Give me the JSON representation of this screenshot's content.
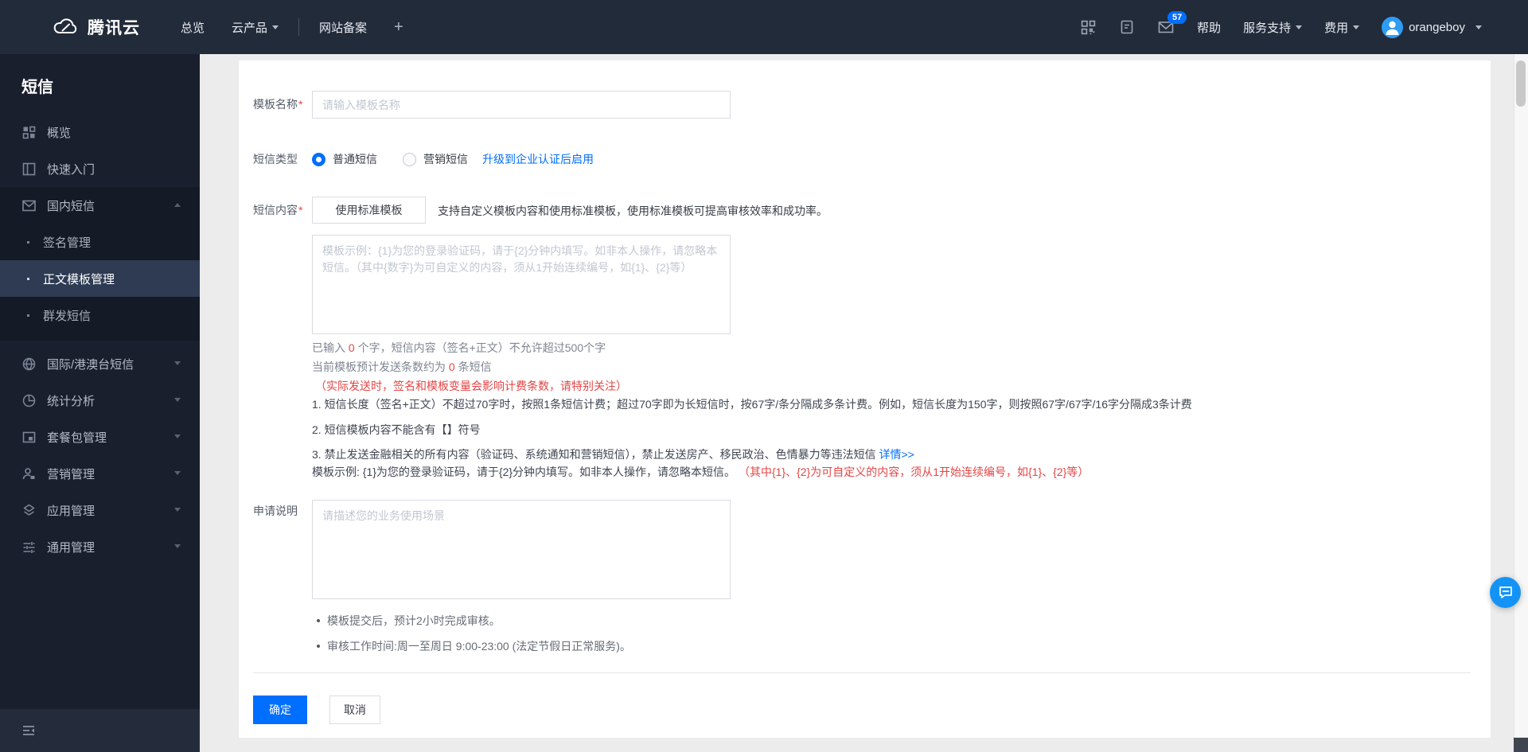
{
  "colors": {
    "accent": "#006eff",
    "danger_red": "#e54545",
    "navbar_bg": "#222b3a",
    "sidebar_bg": "#191f2d",
    "sidebar_active_bg": "#2e3b52",
    "chat_button_blue": "#1493f6"
  },
  "navbar": {
    "brand": "腾讯云",
    "overview": "总览",
    "products": "云产品",
    "beian": "网站备案",
    "plus": "+",
    "mail_badge": "57",
    "help": "帮助",
    "support": "服务支持",
    "billing": "费用",
    "username": "orangeboy",
    "icons": [
      "qr-code-icon",
      "document-icon",
      "mail-icon",
      "avatar"
    ]
  },
  "sidebar": {
    "title": "短信",
    "items": [
      {
        "label": "概览",
        "icon": "grid-icon"
      },
      {
        "label": "快速入门",
        "icon": "quickstart-icon"
      },
      {
        "label": "国内短信",
        "icon": "envelope-icon",
        "expanded": true
      },
      {
        "label": "国际/港澳台短信",
        "icon": "globe-icon"
      },
      {
        "label": "统计分析",
        "icon": "pie-chart-icon"
      },
      {
        "label": "套餐包管理",
        "icon": "package-icon"
      },
      {
        "label": "营销管理",
        "icon": "person-icon"
      },
      {
        "label": "应用管理",
        "icon": "layers-icon"
      },
      {
        "label": "通用管理",
        "icon": "sliders-icon"
      }
    ],
    "sub_items": [
      {
        "label": "签名管理",
        "active": false
      },
      {
        "label": "正文模板管理",
        "active": true
      },
      {
        "label": "群发短信",
        "active": false
      }
    ]
  },
  "form": {
    "template_name": {
      "label": "模板名称",
      "required": "*",
      "placeholder": "请输入模板名称"
    },
    "sms_type": {
      "label": "短信类型",
      "option1": "普通短信",
      "option2": "营销短信",
      "upgrade_link": "升级到企业认证后启用"
    },
    "sms_content": {
      "label": "短信内容",
      "required": "*",
      "standard_template_button": "使用标准模板",
      "hint": "支持自定义模板内容和使用标准模板，使用标准模板可提高审核效率和成功率。",
      "placeholder": "模板示例：{1}为您的登录验证码，请于{2}分钟内填写。如非本人操作，请忽略本短信。（其中{数字}为可自定义的内容，须从1开始连续编号，如{1}、{2}等）",
      "count_prefix": "已输入 ",
      "count_value": "0",
      "count_suffix": " 个字，短信内容（签名+正文）不允许超过500个字",
      "estimate_prefix": "当前模板预计发送条数约为 ",
      "estimate_value": "0",
      "estimate_suffix": " 条短信",
      "billing_warning": "（实际发送时，签名和模板变量会影响计费条数，请特别关注）",
      "rule1": "1. 短信长度（签名+正文）不超过70字时，按照1条短信计费；超过70字即为长短信时，按67字/条分隔成多条计费。例如，短信长度为150字，则按照67字/67字/16字分隔成3条计费",
      "rule2": "2. 短信模板内容不能含有【】符号",
      "rule3": "3. 禁止发送金融相关的所有内容（验证码、系统通知和营销短信），禁止发送房产、移民政治、色情暴力等违法短信 ",
      "rule3_link": "详情>>",
      "example_prefix": "模板示例: {1}为您的登录验证码，请于{2}分钟内填写。如非本人操作，请忽略本短信。 ",
      "example_note": "（其中{1}、{2}为可自定义的内容，须从1开始连续编号，如{1}、{2}等）"
    },
    "application_note": {
      "label": "申请说明",
      "placeholder": "请描述您的业务使用场景"
    },
    "notes": [
      {
        "text": "模板提交后，预计2小时完成审核。"
      },
      {
        "text": "审核工作时间:周一至周日 9:00-23:00 (法定节假日正常服务)。"
      }
    ],
    "submit_button": "确定",
    "cancel_button": "取消"
  }
}
